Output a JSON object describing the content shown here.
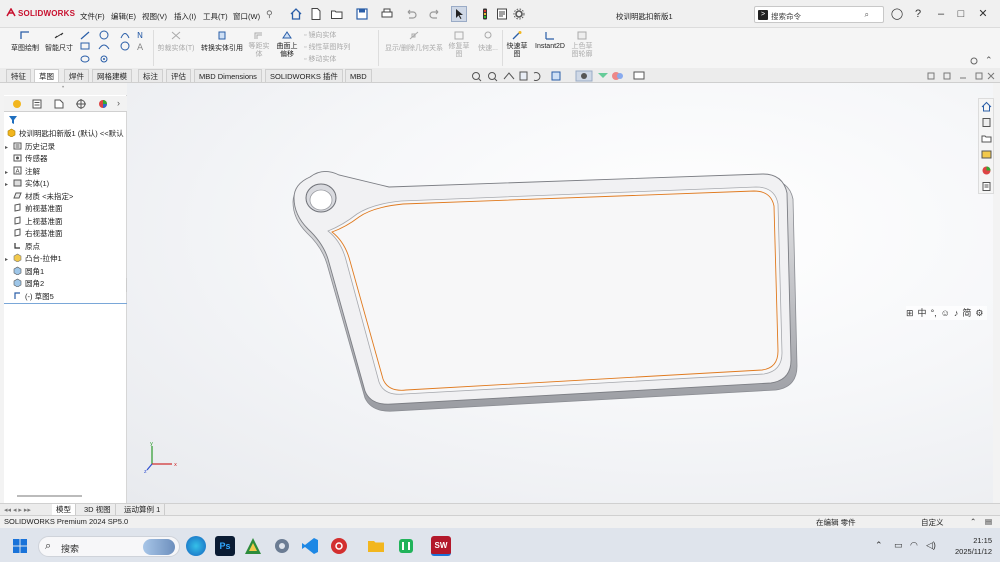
{
  "app": {
    "logo": "SOLIDWORKS",
    "document_title": "校训明匙扣新版1"
  },
  "menu": [
    "文件(F)",
    "编辑(E)",
    "视图(V)",
    "插入(I)",
    "工具(T)",
    "窗口(W)"
  ],
  "search": {
    "placeholder": "搜索命令"
  },
  "command_manager": {
    "sketch": "草图绘制",
    "smart_dim": "智能尺寸",
    "trim": "剪裁实体(T)",
    "convert": "转换实体引用",
    "equidistant": "等距实体",
    "offset_on_surface": "曲面上偏移",
    "mirror": "镜向实体",
    "linear_pattern": "线性草图阵列",
    "move": "移动实体",
    "show_relations": "显示/删除几何关系",
    "repair": "修复草图",
    "quick_snap": "快速...",
    "rapid_sketch": "快速草图",
    "instant2d": "Instant2D",
    "shaded_sketch": "上色草图轮廓"
  },
  "tabs": [
    "特征",
    "草图",
    "焊件",
    "网格建模",
    "标注",
    "评估",
    "MBD Dimensions",
    "SOLIDWORKS 插件",
    "MBD"
  ],
  "active_tab": 1,
  "feature_tree": {
    "root": "校训明匙扣新版1 (默认) <<默认",
    "items": [
      {
        "label": "历史记录",
        "arrow": "▸",
        "icon": "history-icon"
      },
      {
        "label": "传感器",
        "arrow": "",
        "icon": "sensor-icon"
      },
      {
        "label": "注解",
        "arrow": "▸",
        "icon": "annotation-icon"
      },
      {
        "label": "实体(1)",
        "arrow": "▸",
        "icon": "solid-body-icon"
      },
      {
        "label": "材质 <未指定>",
        "arrow": "",
        "icon": "material-icon"
      },
      {
        "label": "前视基准面",
        "arrow": "",
        "icon": "plane-icon"
      },
      {
        "label": "上视基准面",
        "arrow": "",
        "icon": "plane-icon"
      },
      {
        "label": "右视基准面",
        "arrow": "",
        "icon": "plane-icon"
      },
      {
        "label": "原点",
        "arrow": "",
        "icon": "origin-icon"
      },
      {
        "label": "凸台-拉伸1",
        "arrow": "▸",
        "icon": "extrude-icon"
      },
      {
        "label": "圆角1",
        "arrow": "",
        "icon": "fillet-icon"
      },
      {
        "label": "圆角2",
        "arrow": "",
        "icon": "fillet-icon"
      },
      {
        "label": "(-) 草图5",
        "arrow": "",
        "icon": "sketch-icon"
      }
    ]
  },
  "ime_bar": [
    "中",
    "简"
  ],
  "model_tabs": [
    "模型",
    "3D 视图",
    "运动算例 1"
  ],
  "status": {
    "version": "SOLIDWORKS Premium 2024 SP5.0",
    "mode": "在编辑 零件",
    "custom": "自定义"
  },
  "taskbar": {
    "search_placeholder": "搜索",
    "time": "21:15",
    "date": "2025/11/12"
  },
  "colors": {
    "brand": "#c8102e",
    "accent": "#1f6fbf",
    "sketch_edge": "#e07a1f"
  }
}
